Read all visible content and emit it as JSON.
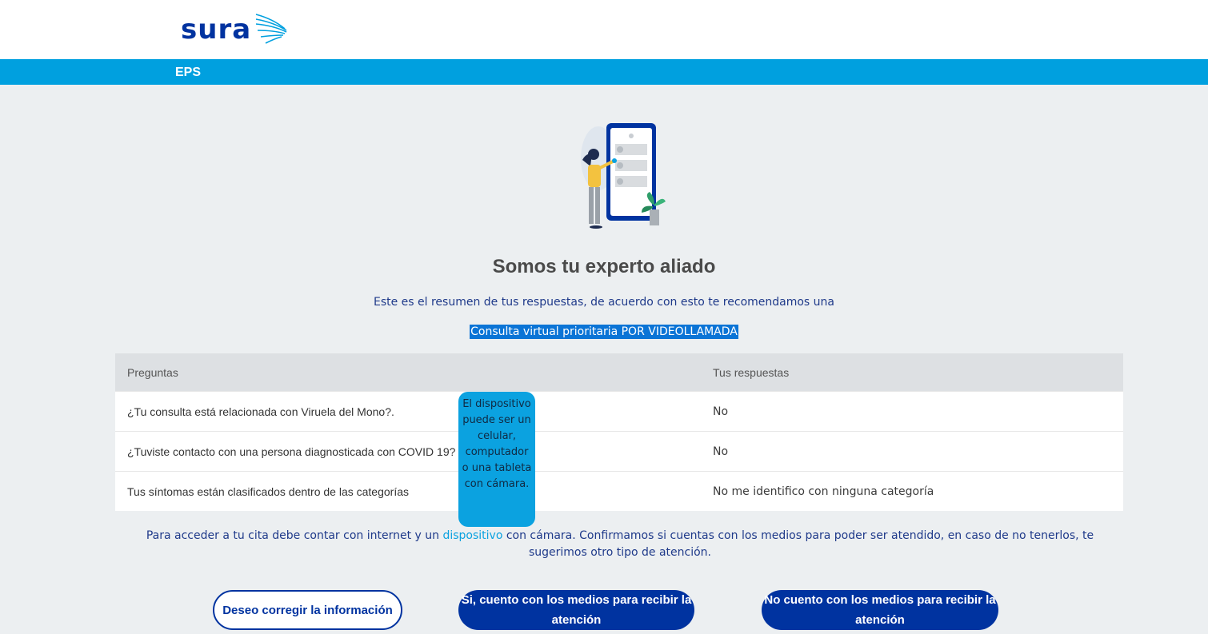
{
  "header": {
    "logo_text": "sura",
    "section_label": "EPS"
  },
  "main": {
    "title": "Somos tu experto aliado",
    "intro": "Este es el resumen de tus respuestas, de acuerdo con esto te recomendamos una",
    "recommendation": "Consulta virtual prioritaria POR VIDEOLLAMADA"
  },
  "table": {
    "headers": [
      "Preguntas",
      "Tus respuestas"
    ],
    "rows": [
      {
        "question": "¿Tu consulta está relacionada con Viruela del Mono?.",
        "answer": "No"
      },
      {
        "question": "¿Tuviste contacto con una persona diagnosticada con COVID 19?",
        "answer": "No"
      },
      {
        "question": "Tus síntomas están clasificados dentro de las categorías",
        "answer": "No me identifico con ninguna categoría"
      }
    ]
  },
  "tooltip": {
    "text": "El dispositivo puede ser un celular, computador o una tableta con cámara."
  },
  "notice": {
    "before_link": "Para acceder a tu cita debe contar con internet y un ",
    "link": "dispositivo",
    "after_link": " con cámara. Confirmamos si cuentas con los medios para poder ser atendido, en caso de no tenerlos, te sugerimos otro tipo de atención."
  },
  "buttons": {
    "correct": "Deseo corregir la información",
    "yes": "Si, cuento con los medios para recibir la atención",
    "no": "No cuento con los medios para recibir la atención"
  },
  "colors": {
    "brand_blue": "#0033a0",
    "accent_cyan": "#00a0df",
    "background": "#eceff1"
  }
}
